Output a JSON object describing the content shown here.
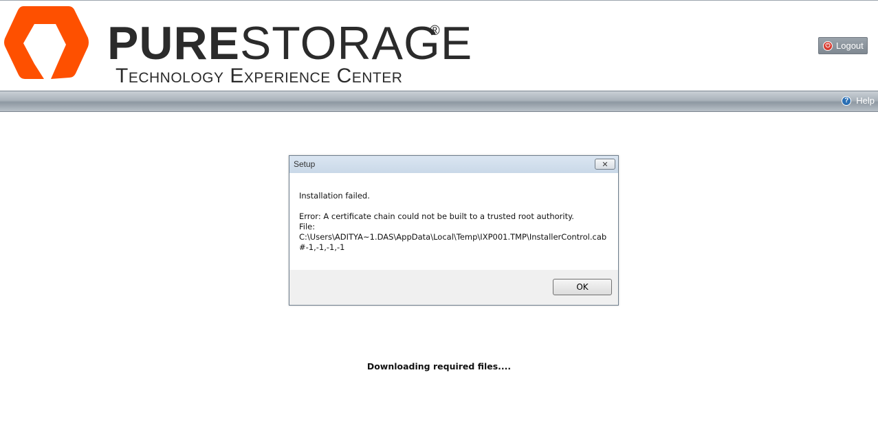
{
  "header": {
    "brand_part1": "PURE",
    "brand_part2": "STORAGE",
    "brand_reg": "®",
    "brand_subtitle": "Technology Experience Center",
    "logout_label": "Logout",
    "logo_icon": "purestorage-logo-icon",
    "logout_icon": "power-icon"
  },
  "nav": {
    "help_label": "Help",
    "help_icon": "help-icon"
  },
  "dialog": {
    "title": "Setup",
    "close_icon": "close-icon",
    "message": {
      "line1": "Installation failed.",
      "line2": "Error: A certificate chain could not be built to a trusted root authority.",
      "line3": "File:",
      "line4": "C:\\Users\\ADITYA~1.DAS\\AppData\\Local\\Temp\\IXP001.TMP\\InstallerControl.cab",
      "line5": "#-1,-1,-1,-1"
    },
    "ok_label": "OK"
  },
  "status": {
    "text": "Downloading required files...."
  },
  "colors": {
    "brand_orange": "#fe5000",
    "brand_text": "#2b2b2b",
    "nav_bar": "#9aa3ab",
    "dialog_titlebar": "#d5e2ef"
  }
}
